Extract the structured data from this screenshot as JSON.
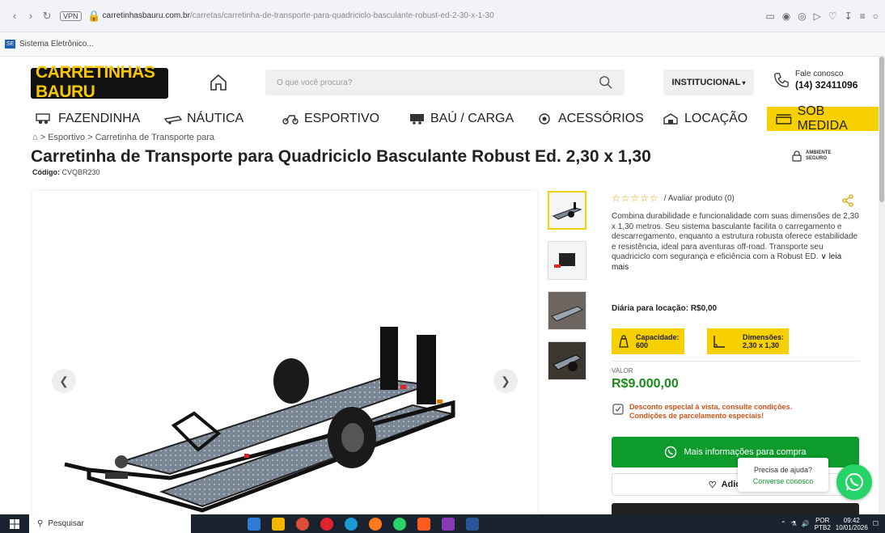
{
  "browser": {
    "vpn": "VPN",
    "url_domain": "carretinhasbauru.com.br",
    "url_path": "/carretas/carretinha-de-transporte-para-quadriciclo-basculante-robust-ed-2-30-x-1-30",
    "bookmark": "Sistema Eletrônico..."
  },
  "header": {
    "logo_text": "CARRETINHAS BAURU",
    "search_placeholder": "O que você procura?",
    "institutional": "INSTITUCIONAL",
    "contact_label": "Fale conosco",
    "phone": "(14) 32411096"
  },
  "nav": {
    "items": [
      "FAZENDINHA",
      "NÁUTICA",
      "ESPORTIVO",
      "BAÚ / CARGA",
      "ACESSÓRIOS",
      "LOCAÇÃO",
      "SOB MEDIDA"
    ]
  },
  "breadcrumb": {
    "parts": [
      "Esportivo",
      "Carretinha de Transporte para"
    ]
  },
  "product": {
    "title": "Carretinha de Transporte para Quadriciclo Basculante Robust Ed. 2,30 x 1,30",
    "code_label": "Código:",
    "code": "CVQBR230",
    "secure_line1": "AMBIENTE",
    "secure_line2": "SEGURO",
    "rating_text": "/ Avaliar produto (0)",
    "description": "Combina durabilidade e funcionalidade com suas dimensões de 2,30 x 1,30 metros. Seu sistema basculante facilita o carregamento e descarregamento, enquanto a estrutura robusta oferece estabilidade e resistência, ideal para aventuras off-road. Transporte seu quadriciclo com segurança e eficiência com a Robust ED.",
    "read_more": "leia mais",
    "daily_rental": "Diária para locação: R$0,00",
    "capacity_label": "Capacidade:",
    "capacity_value": "600",
    "dimensions_label": "Dimensões:",
    "dimensions_value": "2,30 x 1,30",
    "value_label": "VALOR",
    "price": "R$9.000,00",
    "discount_line1": "Desconto especial à vista, consulte condições.",
    "discount_line2": "Condições de parcelamento especiais!",
    "cta": "Mais informações para compra",
    "add_button": "Adicionar"
  },
  "chat": {
    "question": "Precisa de ajuda?",
    "action": "Converse conosco"
  },
  "taskbar": {
    "search": "Pesquisar",
    "lang1": "POR",
    "lang2": "PTB2",
    "time": "09:42",
    "date": "10/01/2026"
  },
  "colors": {
    "brand_yellow": "#f7d000",
    "cta_green": "#0d9b2b",
    "price_green": "#1a8a1a",
    "discount_orange": "#d0541c"
  }
}
